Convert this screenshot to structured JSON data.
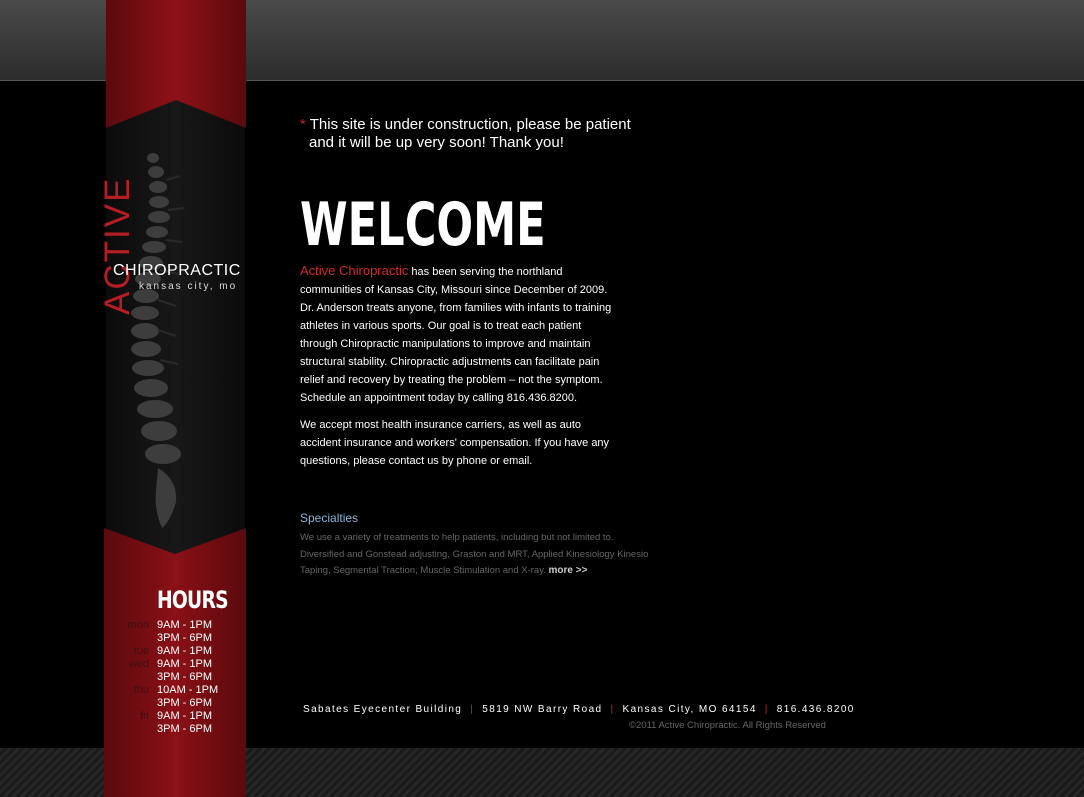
{
  "notice": {
    "star": "*",
    "line1": "This site is under construction, please be patient",
    "line2": "and it will be up very soon! Thank you!"
  },
  "logo": {
    "active": "ACTIVE",
    "chiropractic": "CHIROPRACTIC",
    "city": "kansas city, mo"
  },
  "welcome": {
    "title": "WELCOME",
    "brand": "Active Chiropractic",
    "paragraph1": " has been serving the northland communities of Kansas City, Missouri since December of 2009. Dr. Anderson treats anyone, from families with infants to training athletes in various sports. Our goal is to treat each patient through Chiropractic manipulations to improve and maintain structural stability. Chiropractic adjustments can facilitate pain relief and recovery by treating the problem – not the symptom. Schedule an appointment today by calling 816.436.8200.",
    "paragraph2": "We accept most health insurance carriers, as well as auto accident insurance and workers' compensation. If you have any questions, please contact us by phone or email."
  },
  "specialties": {
    "title": "Specialties",
    "text": "We use a variety of treatments to help patients, including but not limited to. Diversified and Gonstead adjusting, Graston and MRT, Applied Kinesiology Kinesio Taping, Segmental Traction, Muscle Stimulation and X-ray.",
    "more": "more >>"
  },
  "hours": {
    "title": "HOURS",
    "rows": [
      {
        "day": "mon",
        "time": "9AM - 1PM"
      },
      {
        "day": "",
        "time": "3PM - 6PM"
      },
      {
        "day": "tue",
        "time": "9AM - 1PM"
      },
      {
        "day": "wed",
        "time": "9AM - 1PM"
      },
      {
        "day": "",
        "time": "3PM - 6PM"
      },
      {
        "day": "thu",
        "time": "10AM - 1PM"
      },
      {
        "day": "",
        "time": "3PM - 6PM"
      },
      {
        "day": "fri",
        "time": "9AM - 1PM"
      },
      {
        "day": "",
        "time": "3PM - 6PM"
      }
    ]
  },
  "footer": {
    "building": "Sabates Eyecenter Building",
    "street": "5819 NW Barry Road",
    "city": "Kansas City, MO 64154",
    "phone": "816.436.8200",
    "separator": "|",
    "copyright": "©2011 Active Chiropractic. All Rights Reserved"
  },
  "colors": {
    "accent_red": "#b41d23",
    "specialties_blue": "#8ab4d6",
    "background": "#000000"
  }
}
